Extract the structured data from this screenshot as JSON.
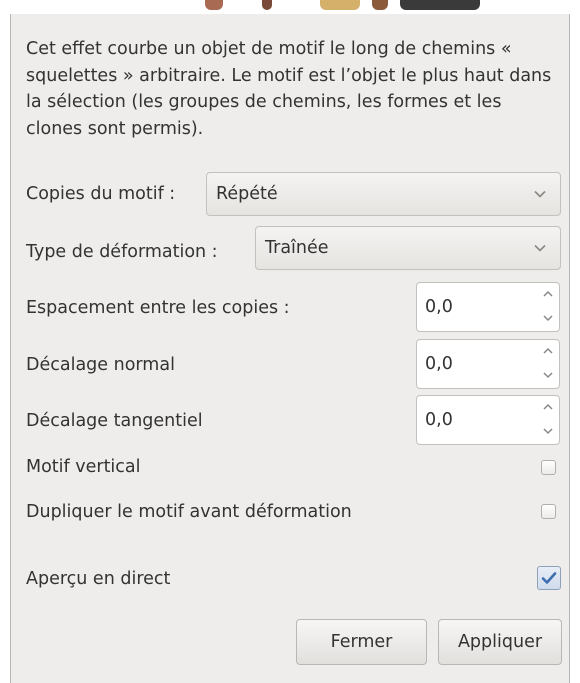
{
  "description": "Cet effet courbe un objet de motif le long de chemins « squelettes » arbitraire. Le motif est l’objet le plus haut dans la sélection (les groupes de chemins, les formes et les clones sont permis).",
  "copies": {
    "label": "Copies du motif :",
    "value": "Répété"
  },
  "deformation": {
    "label": "Type de déformation :",
    "value": "Traînée"
  },
  "spacing": {
    "label": "Espacement entre les copies :",
    "value": "0,0"
  },
  "normal_offset": {
    "label": "Décalage normal",
    "value": "0,0"
  },
  "tangential_offset": {
    "label": "Décalage tangentiel",
    "value": "0,0"
  },
  "vertical_pattern": {
    "label": "Motif vertical",
    "checked": false
  },
  "duplicate_pattern": {
    "label": "Dupliquer le motif avant déformation",
    "checked": false
  },
  "live_preview": {
    "label": "Aperçu en direct",
    "checked": true
  },
  "buttons": {
    "close": "Fermer",
    "apply": "Appliquer"
  },
  "colors": {
    "check_accent": "#3e6db0",
    "dialog_bg": "#eeedeb"
  },
  "icons": {
    "combo": "chevron-down-icon",
    "spin_up": "chevron-up-icon",
    "spin_down": "chevron-down-icon",
    "check": "checkmark-icon"
  }
}
